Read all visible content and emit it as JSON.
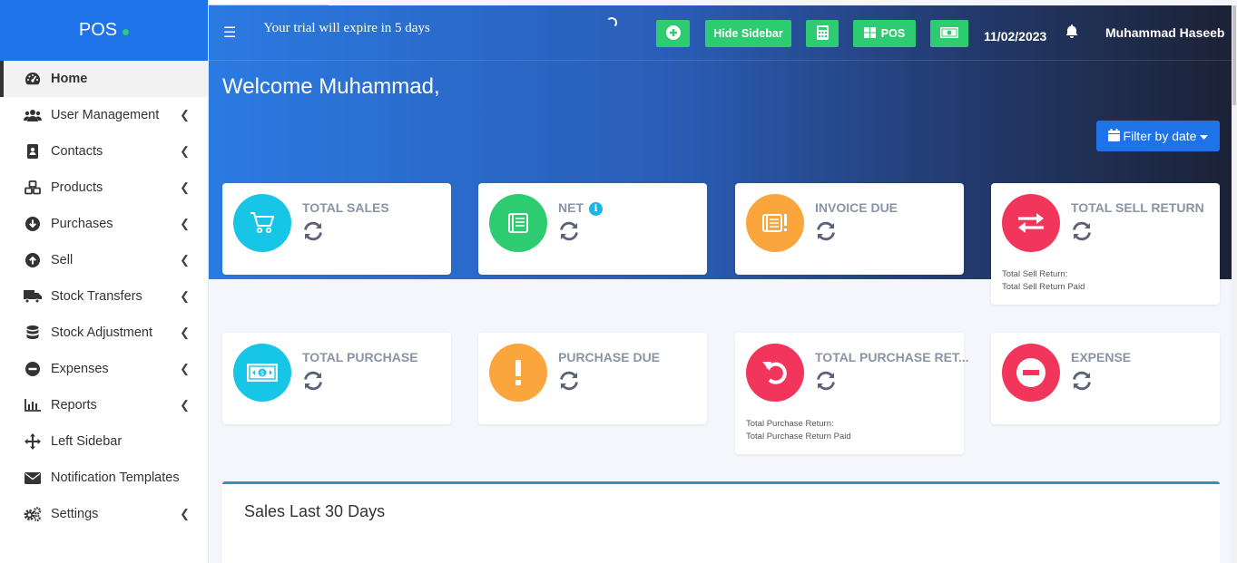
{
  "brand": {
    "name": "POS"
  },
  "header": {
    "trial_text": "Your trial will expire in 5 days",
    "hide_sidebar_label": "Hide Sidebar",
    "pos_label": "POS",
    "date": "11/02/2023",
    "user_name": "Muhammad Haseeb"
  },
  "sidebar": {
    "items": [
      {
        "label": "Home",
        "icon": "dashboard-icon"
      },
      {
        "label": "User Management",
        "icon": "users-icon"
      },
      {
        "label": "Contacts",
        "icon": "address-book-icon"
      },
      {
        "label": "Products",
        "icon": "cubes-icon"
      },
      {
        "label": "Purchases",
        "icon": "arrow-circle-down-icon"
      },
      {
        "label": "Sell",
        "icon": "arrow-circle-up-icon"
      },
      {
        "label": "Stock Transfers",
        "icon": "truck-icon"
      },
      {
        "label": "Stock Adjustment",
        "icon": "database-icon"
      },
      {
        "label": "Expenses",
        "icon": "minus-circle-icon"
      },
      {
        "label": "Reports",
        "icon": "bar-chart-icon"
      },
      {
        "label": "Left Sidebar",
        "icon": "arrows-move-icon"
      },
      {
        "label": "Notification Templates",
        "icon": "envelope-icon"
      },
      {
        "label": "Settings",
        "icon": "cogs-icon"
      }
    ]
  },
  "main": {
    "welcome": "Welcome Muhammad,",
    "filter_label": "Filter by date",
    "cards": {
      "total_sales": {
        "title": "TOTAL SALES"
      },
      "net": {
        "title": "NET"
      },
      "invoice_due": {
        "title": "INVOICE DUE"
      },
      "total_sell_return": {
        "title": "TOTAL SELL RETURN",
        "note1": "Total Sell Return:",
        "note2": "Total Sell Return Paid"
      },
      "total_purchase": {
        "title": "TOTAL PURCHASE"
      },
      "purchase_due": {
        "title": "PURCHASE DUE"
      },
      "total_purchase_return": {
        "title": "TOTAL PURCHASE RET...",
        "note1": "Total Purchase Return:",
        "note2": "Total Purchase Return Paid"
      },
      "expense": {
        "title": "EXPENSE"
      }
    },
    "sales_title": "Sales Last 30 Days"
  },
  "colors": {
    "brand_blue": "#1e73e8",
    "green": "#2ecc71",
    "cyan": "#17c6e6",
    "orange": "#fba63c",
    "red": "#f2355b"
  }
}
